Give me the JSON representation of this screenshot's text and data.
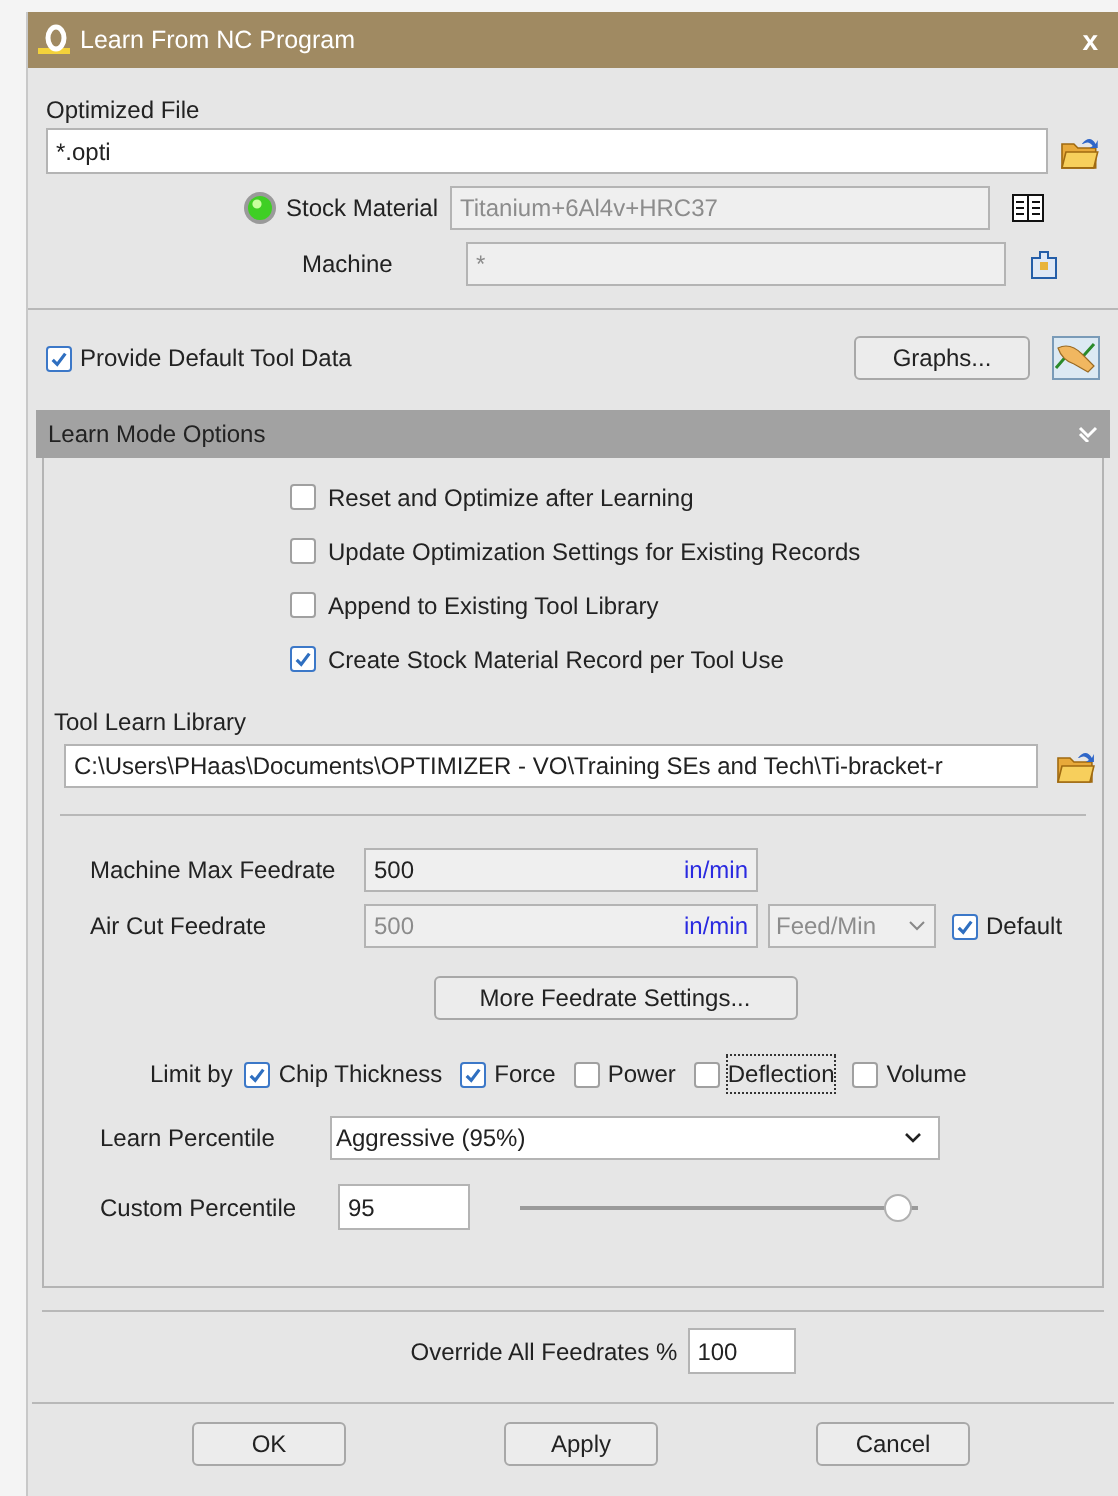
{
  "window": {
    "title": "Learn From NC Program",
    "close": "x"
  },
  "optimized_file": {
    "label": "Optimized File",
    "value": "*.opti"
  },
  "stock_material": {
    "label": "Stock Material",
    "value": "Titanium+6Al4v+HRC37",
    "disabled": true
  },
  "machine": {
    "label": "Machine",
    "value": "*",
    "disabled": true
  },
  "provide_default": {
    "label": "Provide Default Tool Data",
    "checked": true
  },
  "graphs_button": "Graphs...",
  "learn_mode": {
    "title": "Learn Mode Options",
    "expanded": true,
    "options": [
      {
        "label": "Reset and Optimize after Learning",
        "checked": false
      },
      {
        "label": "Update Optimization Settings for Existing Records",
        "checked": false
      },
      {
        "label": "Append to Existing Tool Library",
        "checked": false
      },
      {
        "label": "Create Stock Material Record per Tool Use",
        "checked": true
      }
    ],
    "tool_learn_library": {
      "label": "Tool Learn Library",
      "value": "C:\\Users\\PHaas\\Documents\\OPTIMIZER - VO\\Training SEs and Tech\\Ti-bracket-r"
    },
    "machine_max_feedrate": {
      "label": "Machine Max Feedrate",
      "value": "500",
      "unit": "in/min",
      "disabled": false
    },
    "air_cut_feedrate": {
      "label": "Air Cut Feedrate",
      "value": "500",
      "unit": "in/min",
      "disabled": true,
      "mode": "Feed/Min",
      "default_label": "Default",
      "default_checked": true
    },
    "more_button": "More Feedrate Settings...",
    "limit_by": {
      "label": "Limit by",
      "items": [
        {
          "label": "Chip Thickness",
          "checked": true,
          "focused": false
        },
        {
          "label": "Force",
          "checked": true,
          "focused": false
        },
        {
          "label": "Power",
          "checked": false,
          "focused": false
        },
        {
          "label": "Deflection",
          "checked": false,
          "focused": true
        },
        {
          "label": "Volume",
          "checked": false,
          "focused": false
        }
      ]
    },
    "learn_percentile": {
      "label": "Learn Percentile",
      "value": "Aggressive (95%)"
    },
    "custom_percentile": {
      "label": "Custom Percentile",
      "value": "95",
      "level": 0.95
    }
  },
  "override": {
    "label": "Override All Feedrates %",
    "value": "100"
  },
  "buttons": [
    "OK",
    "Apply",
    "Cancel"
  ]
}
